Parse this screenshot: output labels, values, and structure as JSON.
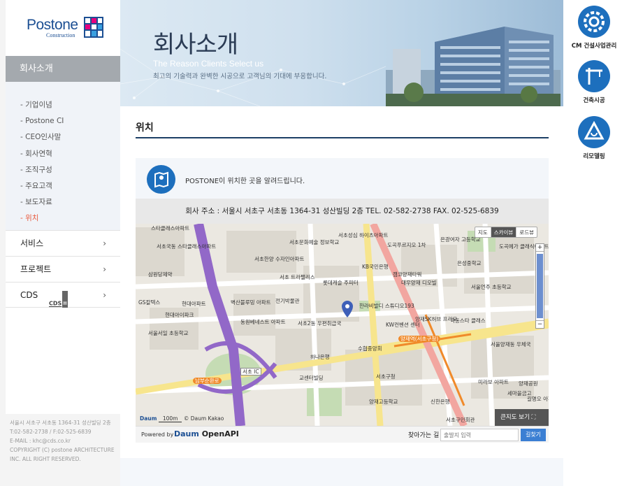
{
  "brand": {
    "name": "Postone",
    "sub": "Construction"
  },
  "sidebar": {
    "section_title": "회사소개",
    "sub_items": [
      {
        "label": "- 기업이념"
      },
      {
        "label": "- Postone CI"
      },
      {
        "label": "- CEO인사말"
      },
      {
        "label": "- 회사연혁"
      },
      {
        "label": "- 조직구성"
      },
      {
        "label": "- 주요고객"
      },
      {
        "label": "- 보도자료"
      },
      {
        "label": "- 위치"
      }
    ],
    "active_sub": "- 위치",
    "menus": [
      {
        "label": "서비스",
        "chevron": "›"
      },
      {
        "label": "프로젝트",
        "chevron": "›"
      },
      {
        "label": "CDS",
        "chevron": "›",
        "badge": "CDS"
      }
    ],
    "footer": {
      "address": "서울시 서초구 서초동 1364-31 성산빌딩 2층",
      "phone": "T:02-582-2738 / F:02-525-6839",
      "email": "E-MAIL : khc@cds.co.kr",
      "copyright": "COPYRIGHT (C) postone ARCHITECTURE INC. ALL RIGHT RESERVED."
    }
  },
  "banner": {
    "title": "회사소개",
    "en_subtitle": "The Reason Clients Select us",
    "ko_subtitle": "최고의 기술력과 완벽한 시공으로 고객님의 기대에 부응합니다."
  },
  "quick_menu": [
    {
      "label": "CM 건설사업관리",
      "icon": "gear-icon"
    },
    {
      "label": "건축시공",
      "icon": "crane-icon"
    },
    {
      "label": "리모델링",
      "icon": "remodel-icon"
    }
  ],
  "content": {
    "page_title": "위치",
    "intro": "POSTONE이 위치한 곳을 알려드립니다.",
    "address_line": "회사 주소 : 서울시 서초구 서초동 1364-31 성산빌딩 2층    TEL. 02-582-2738    FAX. 02-525-6839"
  },
  "map": {
    "tabs": [
      "지도",
      "스카이뷰",
      "로드뷰"
    ],
    "active_tab": "지도",
    "big_map_label": "큰지도 보기",
    "scale_label": "100m",
    "copyright": "© Daum Kakao",
    "labels": [
      "스타클래스아파트",
      "서초국동 스타클래스아파트",
      "서초문화예술 정보학교",
      "서초성심 하이츠아파트",
      "도곡푸르지오 1차",
      "은광여자 고등학교",
      "도곡예가 클래식아파트",
      "서초한양 수자인아파트",
      "KB국민은행",
      "캠코양재타워",
      "서초 트라팰리스",
      "롯데캐슬 주피터",
      "대우양재 디오빌",
      "은성중학교",
      "삼원당제약",
      "서울언주 초등학교",
      "GS칼텍스",
      "현대아파트",
      "벽산블루밍 아파트",
      "전기박물관",
      "한라비발디 스튜디오193",
      "양재SK허브 프리모",
      "극동스타 클래스",
      "현대아이파크",
      "동원베네스트 아파트",
      "서초2동 우편취급국",
      "KW컨벤션 센터",
      "서울서일 초등학교",
      "수협중앙회",
      "서울양재동 우체국",
      "하나은행",
      "교센터빌딩",
      "서초구청",
      "미라보 아파트",
      "양재공원",
      "세마을금고",
      "양재고등학교",
      "신한은행",
      "서초구민회관",
      "길명오 아파",
      "서초 IC",
      "양재역(서초구청)",
      "남부순환로"
    ]
  },
  "map_footer": {
    "powered_by": "Powered by",
    "openapi": "OpenAPI",
    "find_way_label": "찾아가는 길",
    "find_way_placeholder": "출발지 입력",
    "find_button": "길찾기"
  }
}
